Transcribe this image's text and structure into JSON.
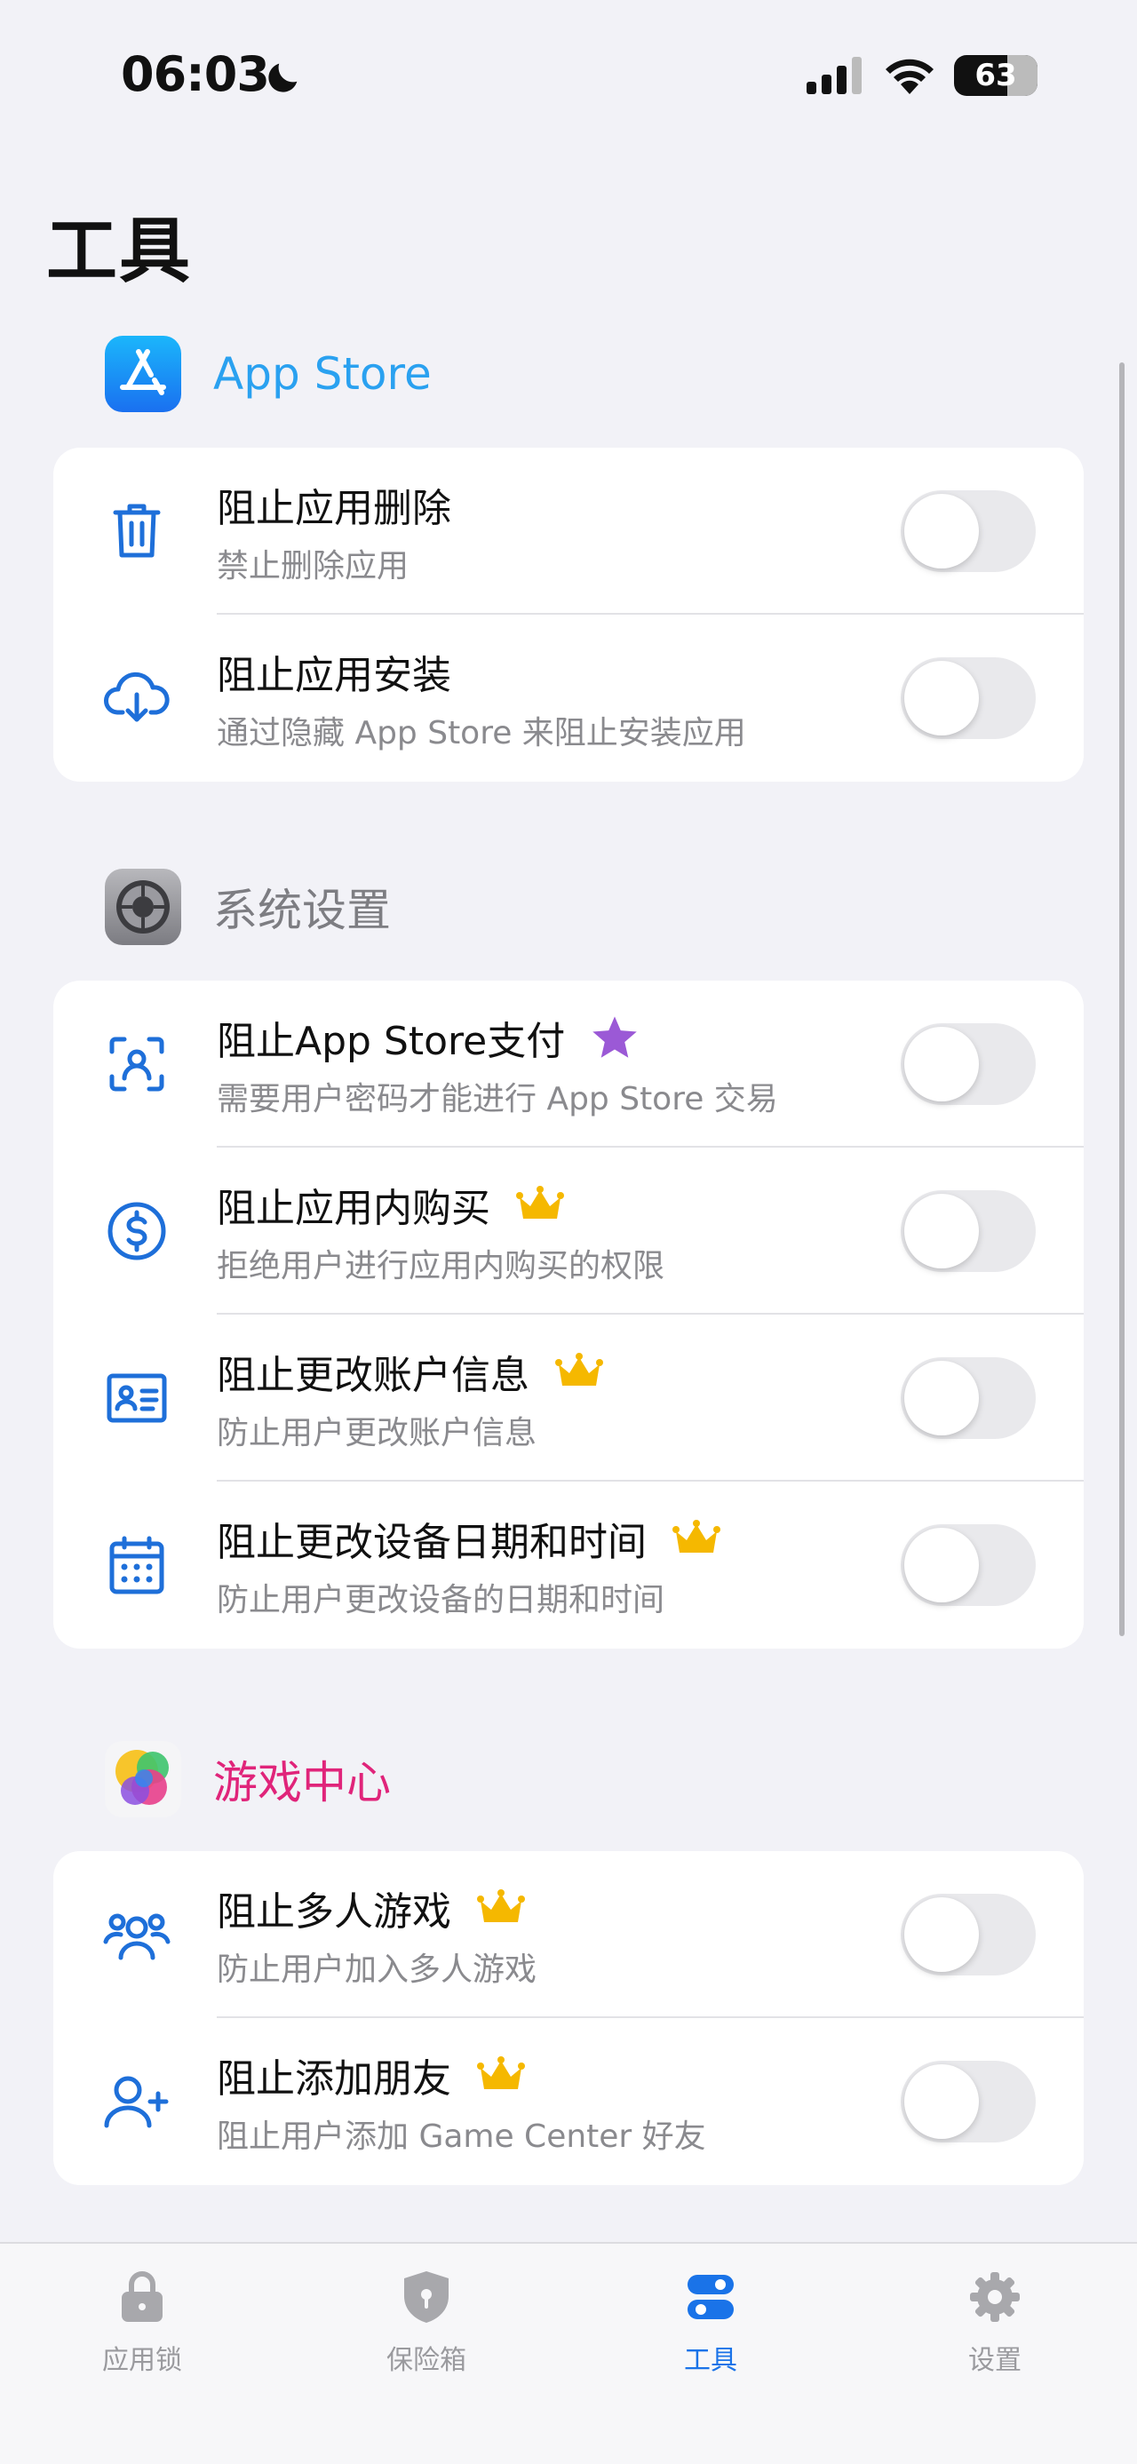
{
  "status_bar": {
    "time": "06:03",
    "battery": "63"
  },
  "page_title": "工具",
  "sections": [
    {
      "title": "App Store",
      "title_color": "#2aa1f0",
      "icon": "app-store-icon",
      "rows": [
        {
          "title": "阻止应用删除",
          "subtitle": "禁止删除应用",
          "icon": "trash-icon",
          "enabled": false
        },
        {
          "title": "阻止应用安装",
          "subtitle": "通过隐藏 App Store 来阻止安装应用",
          "icon": "cloud-download-icon",
          "enabled": false
        }
      ]
    },
    {
      "title": "系统设置",
      "title_color": "#7d7d82",
      "icon": "settings-gear-icon",
      "rows": [
        {
          "title": "阻止App Store支付",
          "subtitle": "需要用户密码才能进行 App Store 交易",
          "icon": "face-id-icon",
          "badge": "star-icon",
          "enabled": false
        },
        {
          "title": "阻止应用内购买",
          "subtitle": "拒绝用户进行应用内购买的权限",
          "icon": "dollar-circle-icon",
          "badge": "crown-icon",
          "enabled": false
        },
        {
          "title": "阻止更改账户信息",
          "subtitle": "防止用户更改账户信息",
          "icon": "id-card-icon",
          "badge": "crown-icon",
          "enabled": false
        },
        {
          "title": "阻止更改设备日期和时间",
          "subtitle": "防止用户更改设备的日期和时间",
          "icon": "calendar-icon",
          "badge": "crown-icon",
          "enabled": false
        }
      ]
    },
    {
      "title": "游戏中心",
      "title_color": "#e0247a",
      "icon": "game-center-icon",
      "rows": [
        {
          "title": "阻止多人游戏",
          "subtitle": "防止用户加入多人游戏",
          "icon": "users-icon",
          "badge": "crown-icon",
          "enabled": false
        },
        {
          "title": "阻止添加朋友",
          "subtitle": "阻止用户添加 Game Center 好友",
          "icon": "add-user-icon",
          "badge": "crown-icon",
          "enabled": false
        }
      ]
    }
  ],
  "tabs": [
    {
      "label": "应用锁",
      "icon": "lock-icon",
      "active": false
    },
    {
      "label": "保险箱",
      "icon": "shield-icon",
      "active": false
    },
    {
      "label": "工具",
      "icon": "tools-icon",
      "active": true
    },
    {
      "label": "设置",
      "icon": "gear-icon",
      "active": false
    }
  ],
  "colors": {
    "accent": "#1a73e8",
    "icon_blue": "#1e6fd9",
    "star": "#9b59d6",
    "crown": "#f5b800",
    "toggle_off": "#e9e9ec",
    "background": "#f2f2f7"
  }
}
